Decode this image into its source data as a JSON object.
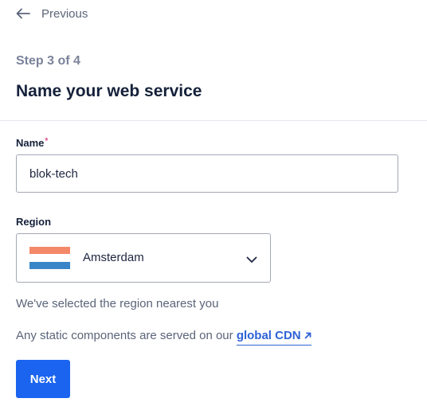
{
  "navigation": {
    "back_label": "Previous",
    "back_icon": "arrow-left-icon"
  },
  "wizard": {
    "step_text": "Step 3 of 4",
    "title": "Name your web service"
  },
  "form": {
    "name": {
      "label": "Name",
      "required_mark": "*",
      "value": "blok-tech"
    },
    "region": {
      "label": "Region",
      "selected": "Amsterdam",
      "flag_icon": "netherlands-flag-icon",
      "dropdown_icon": "chevron-down-icon",
      "helper": "We've selected the region nearest you"
    },
    "cdn_note": {
      "prefix": "Any static components are served on our ",
      "link_label": "global CDN",
      "link_icon": "external-link-arrow-icon"
    }
  },
  "actions": {
    "next_label": "Next"
  },
  "colors": {
    "primary_button": "#1a64ef",
    "link": "#2e62d6",
    "required": "#e0458a",
    "flag_top": "#f4896a",
    "flag_bottom": "#3a85c7"
  }
}
